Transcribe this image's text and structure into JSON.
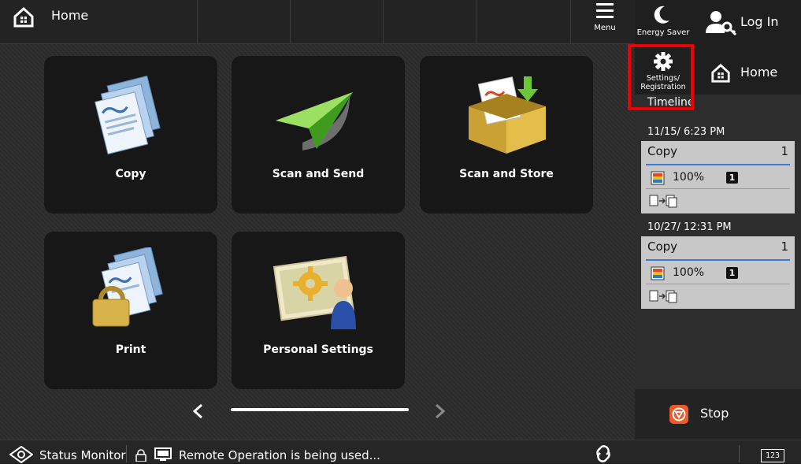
{
  "top": {
    "home_label": "Home",
    "menu_label": "Menu"
  },
  "tiles": [
    {
      "label": "Copy",
      "icon": "copy-icon"
    },
    {
      "label": "Scan and Send",
      "icon": "paper-plane-icon"
    },
    {
      "label": "Scan and Store",
      "icon": "box-icon"
    },
    {
      "label": "Print",
      "icon": "print-lock-icon"
    },
    {
      "label": "Personal Settings",
      "icon": "personal-settings-icon"
    }
  ],
  "side": {
    "energy_saver": "Energy Saver",
    "login": "Log In",
    "settings_line1": "Settings/",
    "settings_line2": "Registration",
    "home": "Home",
    "timeline": "Timeline",
    "jobs": [
      {
        "date": "11/15/ 6:23 PM",
        "name": "Copy",
        "count": "1",
        "percent": "100%",
        "copies_badge": "1"
      },
      {
        "date": "10/27/ 12:31 PM",
        "name": "Copy",
        "count": "1",
        "percent": "100%",
        "copies_badge": "1"
      }
    ],
    "stop": "Stop"
  },
  "status": {
    "monitor": "Status Monitor",
    "remote": "Remote Operation is being used...",
    "keypad": "123"
  },
  "colors": {
    "accent_blue": "#3a7bd5",
    "highlight_red": "#e00000",
    "stop_orange": "#ef5a2a"
  }
}
